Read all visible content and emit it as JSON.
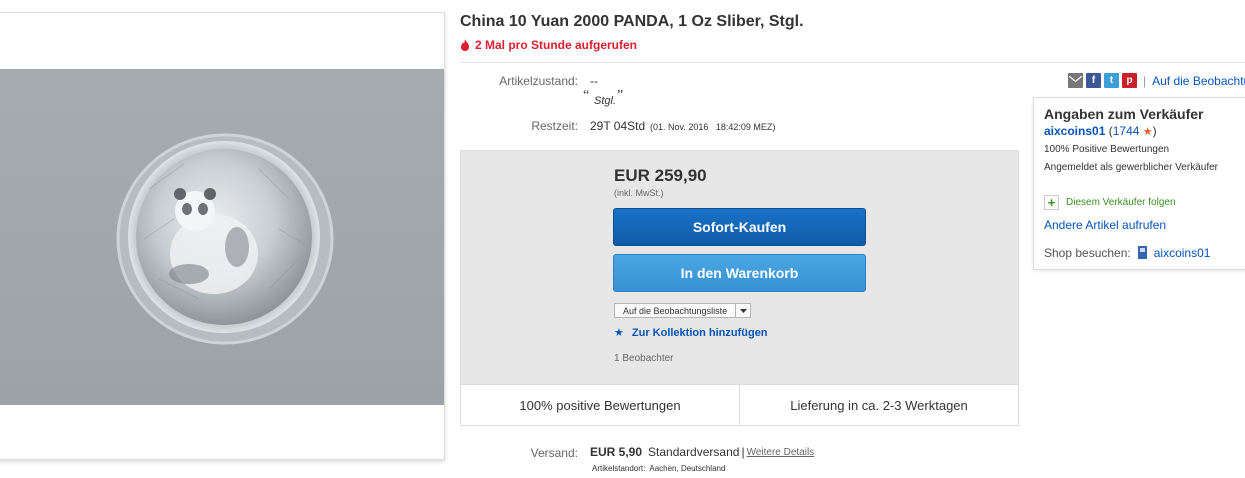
{
  "listing": {
    "title": "China 10 Yuan 2000 PANDA, 1 Oz Sliber, Stgl.",
    "views_notice": "2 Mal pro Stunde aufgerufen"
  },
  "details": {
    "condition_label": "Artikelzustand:",
    "condition_value": "--",
    "condition_note": "Stgl.",
    "time_label": "Restzeit:",
    "time_value": "29T 04Std",
    "time_end": "(01. Nov. 2016   18:42:09 MEZ)"
  },
  "buy_box": {
    "price": "EUR 259,90",
    "vat_note": "(inkl. MwSt.)",
    "buy_now_label": "Sofort-Kaufen",
    "add_to_cart_label": "In den Warenkorb",
    "watchlist_label": "Auf die Beobachtungsliste",
    "collection_label": "Zur Kollektion hinzufügen",
    "watchers": "1 Beobachter",
    "feedback_text": "100% positive Bewertungen",
    "delivery_text": "Lieferung in ca. 2-3 Werktagen"
  },
  "shipping": {
    "label": "Versand:",
    "cost": "EUR 5,90",
    "method": "Standardversand",
    "separator": "|",
    "details_link": "Weitere Details",
    "location": "Artikelstandort:  Aachen, Deutschland"
  },
  "share": {
    "icons": [
      "email-icon",
      "facebook-icon",
      "twitter-icon",
      "pinterest-icon"
    ],
    "separator": "|",
    "watch_link": "Auf die Beobachtungsliste"
  },
  "seller": {
    "heading": "Angaben zum Verkäufer",
    "name": "aixcoins01",
    "feedback_open": "(",
    "feedback_score": "1744",
    "feedback_close": ")",
    "positive": "100% Positive Bewertungen",
    "type": "Angemeldet als gewerblicher Verkäufer",
    "follow_label": "Diesem Verkäufer folgen",
    "other_items": "Andere Artikel aufrufen",
    "shop_label": "Shop besuchen:",
    "shop_name": "aixcoins01"
  },
  "colors": {
    "accent_red": "#dd1e31",
    "link_blue": "#0654ba",
    "buy_button": "#0e5ca8",
    "cart_button": "#3791d4",
    "follow_green": "#3a8e23"
  }
}
